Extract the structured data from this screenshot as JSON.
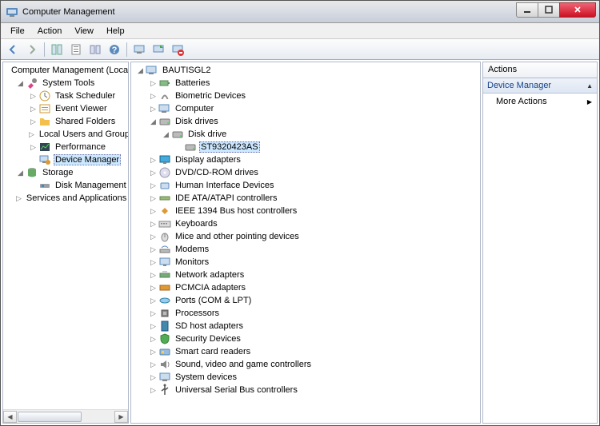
{
  "window": {
    "title": "Computer Management"
  },
  "menu": {
    "file": "File",
    "action": "Action",
    "view": "View",
    "help": "Help"
  },
  "left_tree": {
    "root": "Computer Management (Local",
    "system_tools": "System Tools",
    "task_scheduler": "Task Scheduler",
    "event_viewer": "Event Viewer",
    "shared_folders": "Shared Folders",
    "local_users": "Local Users and Groups",
    "performance": "Performance",
    "device_manager": "Device Manager",
    "storage": "Storage",
    "disk_management": "Disk Management",
    "services_apps": "Services and Applications"
  },
  "center_tree": {
    "root": "BAUTISGL2",
    "batteries": "Batteries",
    "biometric": "Biometric Devices",
    "computer": "Computer",
    "disk_drives": "Disk drives",
    "disk_drive": "Disk drive",
    "selected_disk": "ST9320423AS",
    "display": "Display adapters",
    "dvd": "DVD/CD-ROM drives",
    "hid": "Human Interface Devices",
    "ide": "IDE ATA/ATAPI controllers",
    "ieee1394": "IEEE 1394 Bus host controllers",
    "keyboards": "Keyboards",
    "mice": "Mice and other pointing devices",
    "modems": "Modems",
    "monitors": "Monitors",
    "network": "Network adapters",
    "pcmcia": "PCMCIA adapters",
    "ports": "Ports (COM & LPT)",
    "processors": "Processors",
    "sd": "SD host adapters",
    "security": "Security Devices",
    "smartcard": "Smart card readers",
    "sound": "Sound, video and game controllers",
    "system": "System devices",
    "usb": "Universal Serial Bus controllers"
  },
  "actions": {
    "header": "Actions",
    "section": "Device Manager",
    "more": "More Actions"
  }
}
